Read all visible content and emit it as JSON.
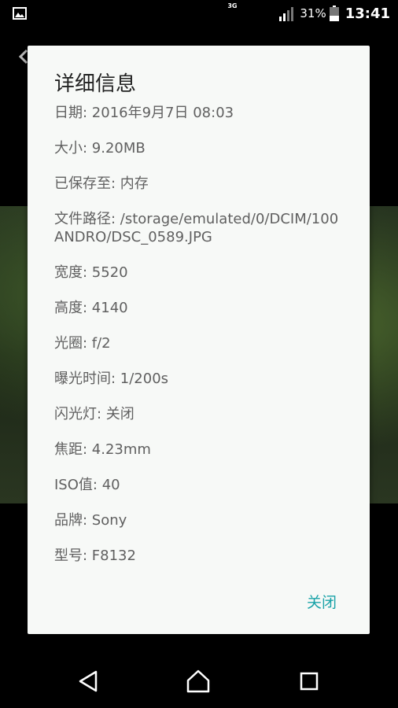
{
  "status_bar": {
    "network": "3G",
    "battery": "31%",
    "time": "13:41"
  },
  "dialog": {
    "title": "详细信息",
    "rows": [
      "日期: 2016年9月7日 08:03",
      "大小: 9.20MB",
      "已保存至: 内存",
      "文件路径: /storage/emulated/0/DCIM/100ANDRO/DSC_0589.JPG",
      "宽度: 5520",
      "高度: 4140",
      "光圈: f/2",
      "曝光时间: 1/200s",
      "闪光灯: 关闭",
      "焦距: 4.23mm",
      "ISO值: 40",
      "品牌: Sony",
      "型号: F8132"
    ],
    "close_label": "关闭"
  },
  "colors": {
    "accent": "#1aa3a8",
    "dialog_bg": "#f7f9f7",
    "text_secondary": "#606060"
  }
}
